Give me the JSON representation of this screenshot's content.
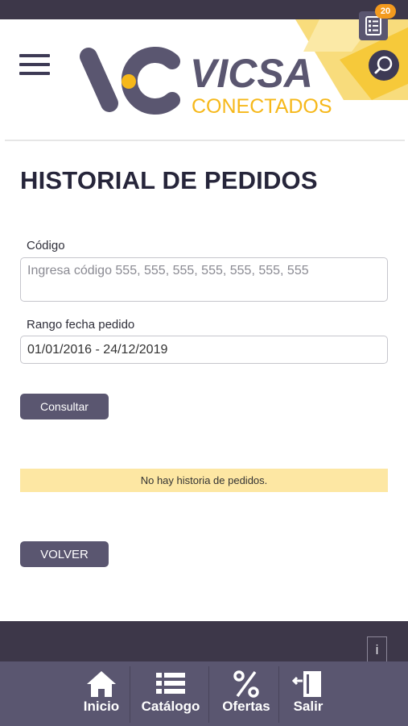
{
  "header": {
    "brand": "VICSA",
    "brand_sub": "CONECTADOS",
    "cart_count": "20",
    "icons": {
      "menu": "hamburger-menu-icon",
      "cart": "order-list-icon",
      "search": "search-icon"
    }
  },
  "page": {
    "title": "HISTORIAL DE PEDIDOS"
  },
  "form": {
    "code_label": "Código",
    "code_placeholder": "Ingresa código 555, 555, 555, 555, 555, 555, 555",
    "date_label": "Rango fecha pedido",
    "date_value": "01/01/2016 - 24/12/2019",
    "submit_label": "Consultar"
  },
  "results": {
    "empty_message": "No hay historia de pedidos."
  },
  "back_label": "VOLVER",
  "info_label": "i",
  "nav": [
    {
      "label": "Inicio",
      "icon": "home-icon"
    },
    {
      "label": "Catálogo",
      "icon": "catalog-list-icon"
    },
    {
      "label": "Ofertas",
      "icon": "percent-icon"
    },
    {
      "label": "Salir",
      "icon": "exit-door-icon"
    }
  ],
  "colors": {
    "dark": "#3d3749",
    "primary": "#5a5670",
    "accent": "#f6b81a",
    "alert_bg": "#fde7a3",
    "badge": "#f39a1e"
  }
}
